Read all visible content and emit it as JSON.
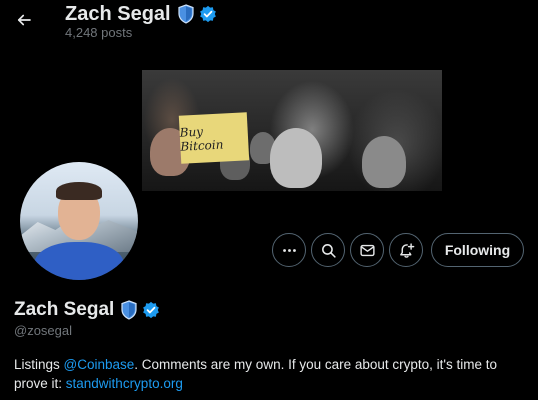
{
  "header": {
    "name": "Zach Segal",
    "posts_count": "4,248 posts"
  },
  "banner": {
    "sign_text": "Buy Bitcoin"
  },
  "actions": {
    "following_label": "Following"
  },
  "profile": {
    "name": "Zach Segal",
    "handle": "@zosegal"
  },
  "bio": {
    "part1": "Listings ",
    "mention": "@Coinbase",
    "part2": ". Comments are my own. If you care about crypto, it's time to prove it: ",
    "link": "standwithcrypto.org"
  },
  "colors": {
    "accent": "#1d9bf0",
    "background": "#000000",
    "text": "#e7e9ea",
    "muted": "#71767b",
    "border": "#536471",
    "shield": "#4a90e2"
  },
  "icons": {
    "back": "arrow-left-icon",
    "shield": "shield-icon",
    "verified": "verified-badge-icon",
    "more": "more-horizontal-icon",
    "search": "search-icon",
    "message": "envelope-icon",
    "notify": "bell-plus-icon"
  }
}
